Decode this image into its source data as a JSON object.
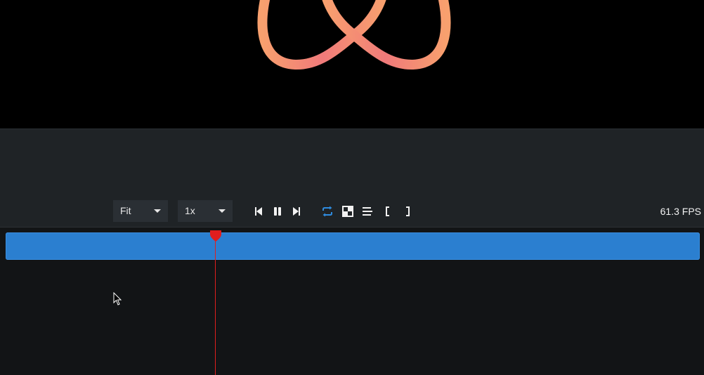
{
  "preview": {
    "stroke_colors": [
      "#f8a06e",
      "#f07a7a"
    ]
  },
  "toolbar": {
    "zoom_select": {
      "value": "Fit",
      "icon": "chevron-down-icon"
    },
    "speed_select": {
      "value": "1x",
      "icon": "chevron-down-icon"
    },
    "buttons": [
      {
        "name": "skip-to-start",
        "icon": "skip-back-icon"
      },
      {
        "name": "pause",
        "icon": "pause-icon"
      },
      {
        "name": "skip-to-end",
        "icon": "skip-forward-icon"
      },
      {
        "name": "loop",
        "icon": "loop-icon",
        "active": true,
        "color": "#2f8ce0"
      },
      {
        "name": "transparency-grid",
        "icon": "checkerboard-icon"
      },
      {
        "name": "align",
        "icon": "align-icon"
      },
      {
        "name": "set-in-point",
        "icon": "left-bracket-icon"
      },
      {
        "name": "set-out-point",
        "icon": "right-bracket-icon"
      }
    ],
    "fps_label": "61.3 FPS"
  },
  "timeline": {
    "track_color": "#2b7fd0",
    "playhead_color": "#e01e1e",
    "playhead_position": 0.303
  }
}
